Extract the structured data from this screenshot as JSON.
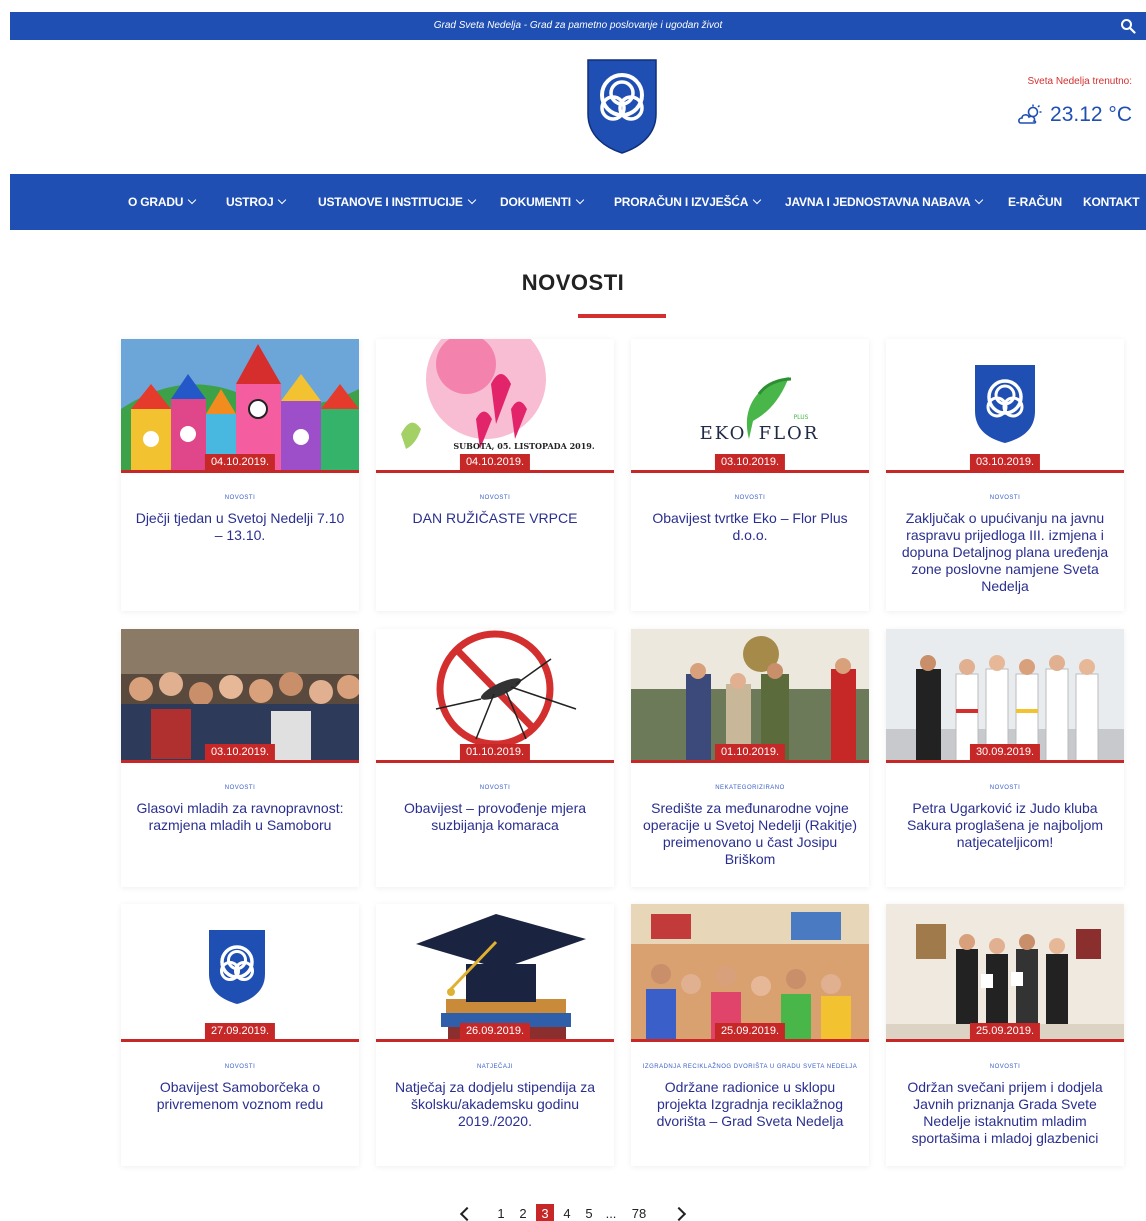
{
  "header": {
    "tagline": "Grad Sveta Nedelja - Grad za pametno poslovanje i ugodan život",
    "search_icon": "search-icon",
    "logo_icon": "city-crest-logo",
    "weather_label": "Sveta Nedelja trenutno:",
    "weather_icon": "partly-cloudy-icon",
    "temperature": "23.12 °C"
  },
  "nav": {
    "items": [
      {
        "label": "O GRADU",
        "dropdown": true
      },
      {
        "label": "USTROJ",
        "dropdown": true
      },
      {
        "label": "USTANOVE I INSTITUCIJE",
        "dropdown": true
      },
      {
        "label": "DOKUMENTI",
        "dropdown": true
      },
      {
        "label": "PRORAČUN I IZVJEŠĆA",
        "dropdown": true
      },
      {
        "label": "JAVNA I JEDNOSTAVNA NABAVA",
        "dropdown": true
      },
      {
        "label": "E-RAČUN",
        "dropdown": false
      },
      {
        "label": "KONTAKT",
        "dropdown": false
      }
    ]
  },
  "section": {
    "title": "NOVOSTI"
  },
  "articles": [
    {
      "date": "04.10.2019.",
      "category": "NOVOSTI",
      "title": "Dječji tjedan u Svetoj Nedelji 7.10 – 13.10."
    },
    {
      "date": "04.10.2019.",
      "category": "NOVOSTI",
      "title": "DAN RUŽIČASTE VRPCE"
    },
    {
      "date": "03.10.2019.",
      "category": "NOVOSTI",
      "title": "Obavijest tvrtke Eko – Flor Plus d.o.o."
    },
    {
      "date": "03.10.2019.",
      "category": "NOVOSTI",
      "title": "Zaključak o upućivanju na javnu raspravu prijedloga III. izmjena i dopuna Detaljnog plana uređenja zone poslovne namjene Sveta Nedelja"
    },
    {
      "date": "03.10.2019.",
      "category": "NOVOSTI",
      "title": "Glasovi mladih za ravnopravnost: razmjena mladih u Samoboru"
    },
    {
      "date": "01.10.2019.",
      "category": "NOVOSTI",
      "title": "Obavijest – provođenje mjera suzbijanja komaraca"
    },
    {
      "date": "01.10.2019.",
      "category": "NEKATEGORIZIRANO",
      "title": "Središte za međunarodne vojne operacije u Svetoj Nedelji (Rakitje) preimenovano u čast Josipu Briškom"
    },
    {
      "date": "30.09.2019.",
      "category": "NOVOSTI",
      "title": "Petra Ugarković iz Judo kluba Sakura proglašena je najboljom natjecateljicom!"
    },
    {
      "date": "27.09.2019.",
      "category": "NOVOSTI",
      "title": "Obavijest Samoborčeka o privremenom voznom redu"
    },
    {
      "date": "26.09.2019.",
      "category": "NATJEČAJI",
      "title": "Natječaj za dodjelu stipendija za školsku/akademsku godinu 2019./2020."
    },
    {
      "date": "25.09.2019.",
      "category": "IZGRADNJA RECIKLAŽNOG DVORIŠTA U GRADU SVETA NEDELJA",
      "title": "Održane radionice u sklopu projekta Izgradnja reciklažnog dvorišta – Grad Sveta Nedelja"
    },
    {
      "date": "25.09.2019.",
      "category": "NOVOSTI",
      "title": "Održan svečani prijem i dodjela Javnih priznanja Grada Svete Nedelje istaknutim mladim sportašima i mladoj glazbenici"
    }
  ],
  "article_images": {
    "0": {
      "text1": ""
    },
    "1": {
      "text1": "SUBOTA, 05. LISTOPADA 2019."
    },
    "2": {
      "text1": "EKO",
      "text2": "FLOR",
      "text3": "PLUS"
    }
  },
  "pagination": {
    "prev_icon": "chevron-left-icon",
    "pages": [
      "1",
      "2",
      "3",
      "4",
      "5",
      "...",
      "78"
    ],
    "current": "3",
    "next_icon": "chevron-right-icon"
  },
  "colors": {
    "brand_blue": "#1f4fb3",
    "accent_red": "#c62828",
    "title_text": "#2a2f8f"
  }
}
